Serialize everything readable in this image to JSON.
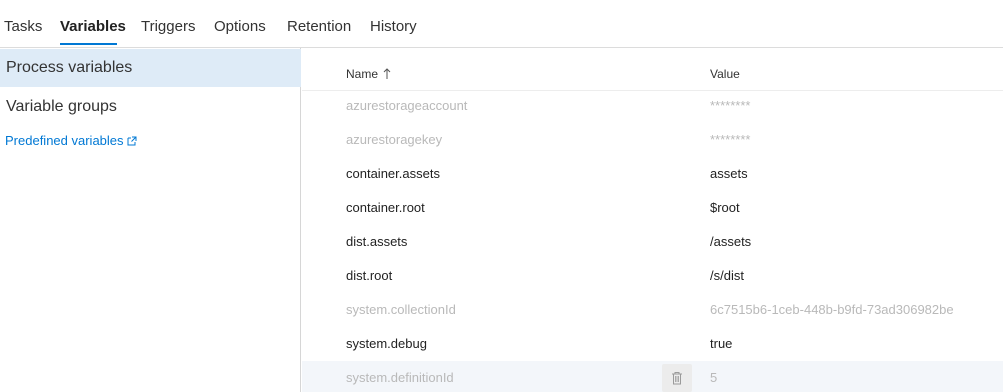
{
  "tabs": [
    {
      "label": "Tasks"
    },
    {
      "label": "Variables"
    },
    {
      "label": "Triggers"
    },
    {
      "label": "Options"
    },
    {
      "label": "Retention"
    },
    {
      "label": "History"
    }
  ],
  "active_tab": "Variables",
  "sidebar": {
    "items": [
      {
        "label": "Process variables"
      },
      {
        "label": "Variable groups"
      }
    ],
    "link_label": "Predefined variables"
  },
  "table": {
    "headers": {
      "name": "Name",
      "value": "Value"
    },
    "rows": [
      {
        "name": "azurestorageaccount",
        "value": "********"
      },
      {
        "name": "azurestoragekey",
        "value": "********"
      },
      {
        "name": "container.assets",
        "value": "assets"
      },
      {
        "name": "container.root",
        "value": "$root"
      },
      {
        "name": "dist.assets",
        "value": "/assets"
      },
      {
        "name": "dist.root",
        "value": "/s/dist"
      },
      {
        "name": "system.collectionId",
        "value": "6c7515b6-1ceb-448b-b9fd-73ad306982be"
      },
      {
        "name": "system.debug",
        "value": "true"
      },
      {
        "name": "system.definitionId",
        "value": "5"
      }
    ]
  },
  "colors": {
    "accent": "#0078d4",
    "selected_bg": "#deebf7"
  }
}
